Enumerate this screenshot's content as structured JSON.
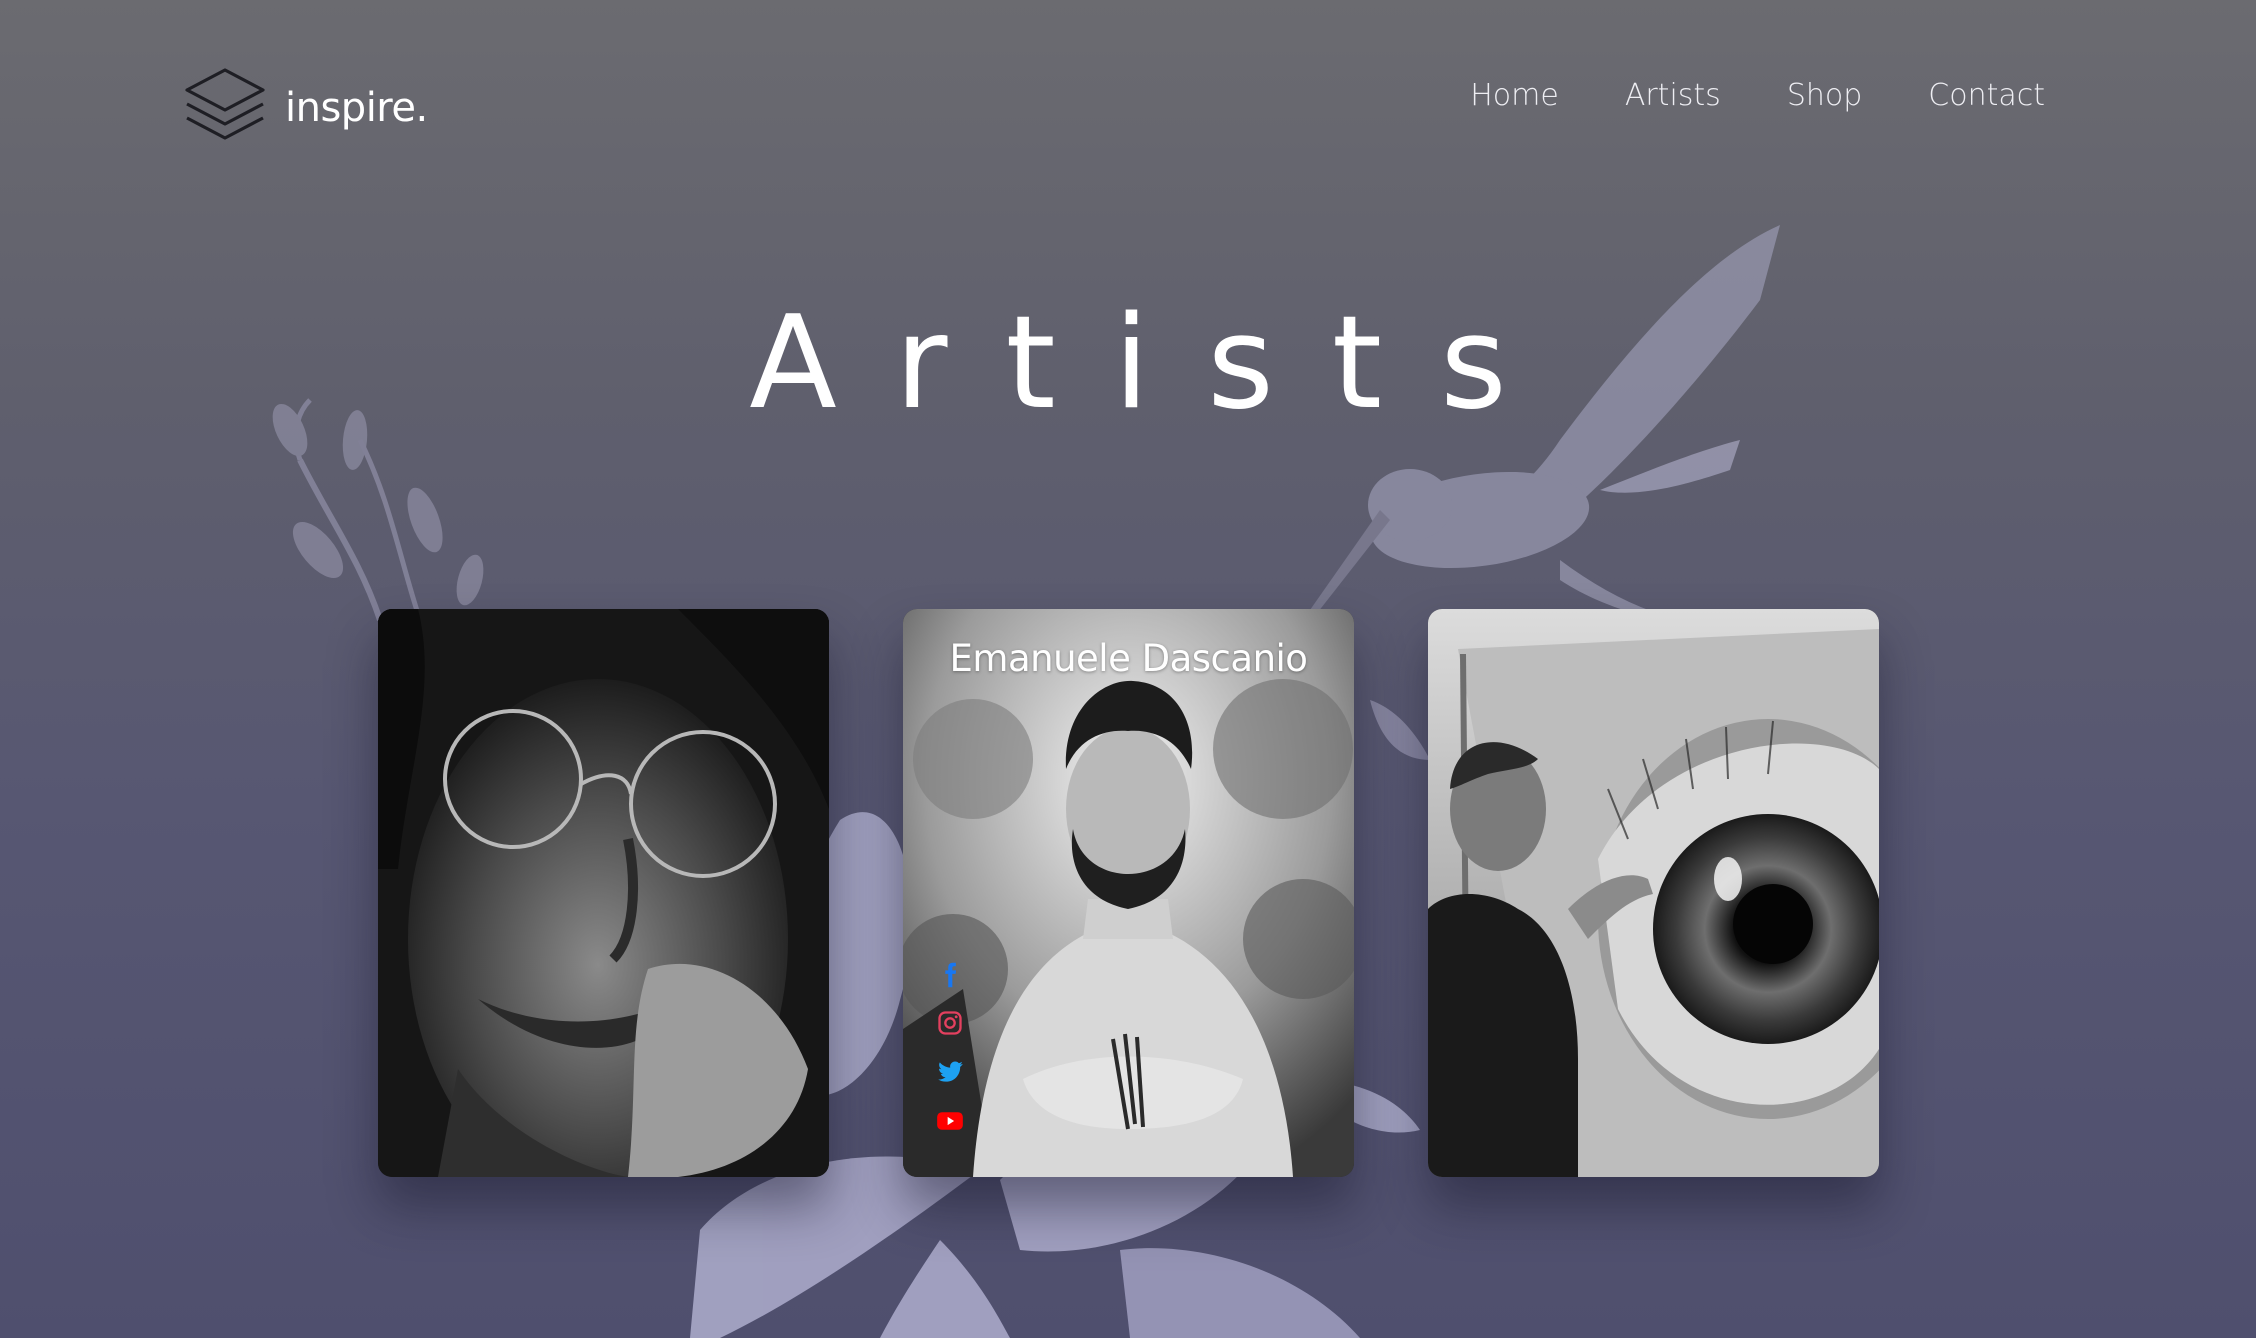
{
  "brand": {
    "name": "inspire.",
    "logo_icon": "stacked-layers-icon"
  },
  "nav": {
    "items": [
      {
        "label": "Home"
      },
      {
        "label": "Artists"
      },
      {
        "label": "Shop"
      },
      {
        "label": "Contact"
      }
    ]
  },
  "hero": {
    "title": "Artists"
  },
  "cards": [
    {
      "name": "",
      "photo": "crying-man-with-glasses-portrait"
    },
    {
      "name": "Emanuele Dascanio",
      "photo": "bearded-man-turtleneck-portrait",
      "social": [
        {
          "icon": "facebook-icon",
          "color": "#1877f2"
        },
        {
          "icon": "instagram-icon",
          "color": "#e4405f"
        },
        {
          "icon": "twitter-icon",
          "color": "#1da1f2"
        },
        {
          "icon": "youtube-icon",
          "color": "#ff0000"
        }
      ]
    },
    {
      "name": "",
      "photo": "artist-drawing-eye"
    }
  ],
  "colors": {
    "background_top": "#6b6b70",
    "background_bottom": "#4f4f6e",
    "decor_lilac": "#a9a8c8",
    "text": "#ffffff"
  }
}
